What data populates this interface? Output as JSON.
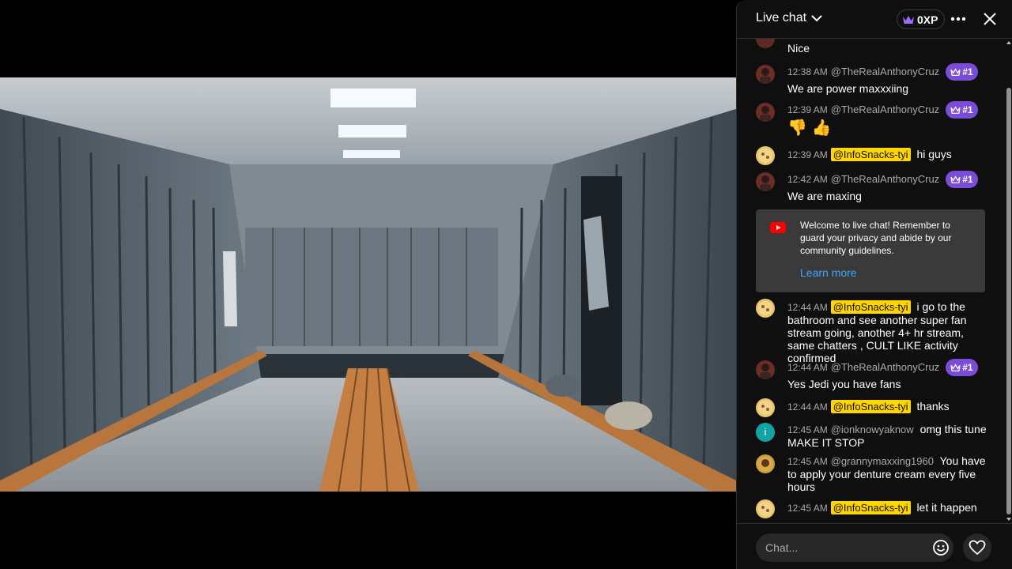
{
  "chat": {
    "title": "Live chat",
    "xp": "0XP",
    "input_placeholder": "Chat...",
    "welcome": {
      "text": "Welcome to live chat! Remember to guard your privacy and abide by our community guidelines.",
      "link": "Learn more"
    },
    "messages": [
      {
        "time": "",
        "author": "",
        "text": "Nice"
      },
      {
        "time": "12:38 AM",
        "author": "@TheRealAnthonyCruz",
        "rank": "#1",
        "text": "We are power maxxxiing"
      },
      {
        "time": "12:39 AM",
        "author": "@TheRealAnthonyCruz",
        "rank": "#1",
        "text": "👎 👍"
      },
      {
        "time": "12:39 AM",
        "author": "@InfoSnacks-tyi",
        "text": "hi guys"
      },
      {
        "time": "12:42 AM",
        "author": "@TheRealAnthonyCruz",
        "rank": "#1",
        "text": "We are maxing"
      },
      {
        "time": "12:44 AM",
        "author": "@InfoSnacks-tyi",
        "text": "i go to the bathroom and see another super fan stream going, another 4+ hr stream, same chatters , CULT LIKE activity confirmed"
      },
      {
        "time": "12:44 AM",
        "author": "@TheRealAnthonyCruz",
        "rank": "#1",
        "text": "Yes Jedi you have fans"
      },
      {
        "time": "12:44 AM",
        "author": "@InfoSnacks-tyi",
        "text": "thanks"
      },
      {
        "time": "12:45 AM",
        "author": "@ionknowyaknow",
        "avatar_letter": "i",
        "text": "omg this tune MAKE IT STOP"
      },
      {
        "time": "12:45 AM",
        "author": "@grannymaxxing1960",
        "text": "You have to apply your denture cream every five hours"
      },
      {
        "time": "12:45 AM",
        "author": "@InfoSnacks-tyi",
        "text": "let it happen"
      }
    ]
  },
  "colors": {
    "panel_bg": "#0f0f0f",
    "rank_badge": "#7b4dd6",
    "highlight_author": "#ffd600",
    "link": "#3ea6ff"
  },
  "icons": {
    "xp": "crown-icon",
    "more": "more-vert-icon",
    "close": "close-icon",
    "dropdown": "chevron-down-icon",
    "welcome": "youtube-icon",
    "emoji": "emoji-icon",
    "like": "heart-icon"
  }
}
